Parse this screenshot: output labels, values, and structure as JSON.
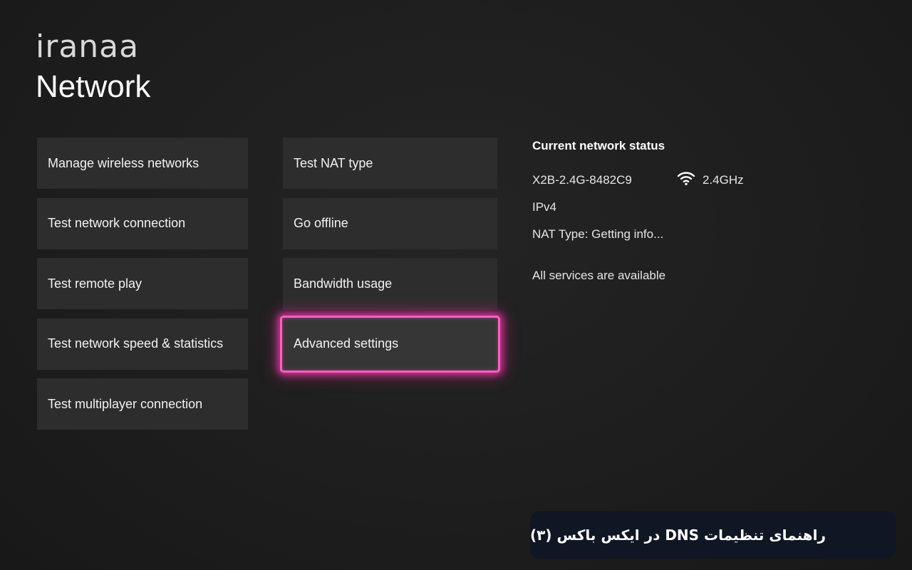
{
  "brand": {
    "logo_text": "iranaa"
  },
  "page": {
    "title": "Network"
  },
  "left_menu": {
    "items": [
      {
        "label": "Manage wireless networks"
      },
      {
        "label": "Test network connection"
      },
      {
        "label": "Test remote play"
      },
      {
        "label": "Test network speed & statistics"
      },
      {
        "label": "Test multiplayer connection"
      }
    ]
  },
  "mid_menu": {
    "items": [
      {
        "label": "Test NAT type"
      },
      {
        "label": "Go offline"
      },
      {
        "label": "Bandwidth usage"
      },
      {
        "label": "Advanced settings",
        "selected": true
      }
    ]
  },
  "status": {
    "heading": "Current network status",
    "ssid": "X2B-2.4G-8482C9",
    "band": "2.4GHz",
    "band_icon": "wifi-icon",
    "ip_version": "IPv4",
    "nat": "NAT Type: Getting info...",
    "services": "All services are available"
  },
  "caption": {
    "text": "راهنمای تنظیمات DNS در ایکس باکس (۳)"
  },
  "colors": {
    "background": "#1e1e1e",
    "tile": "#2d2d2d",
    "focus_glow": "#ff5ec4",
    "caption_bg": "#0f1624"
  }
}
